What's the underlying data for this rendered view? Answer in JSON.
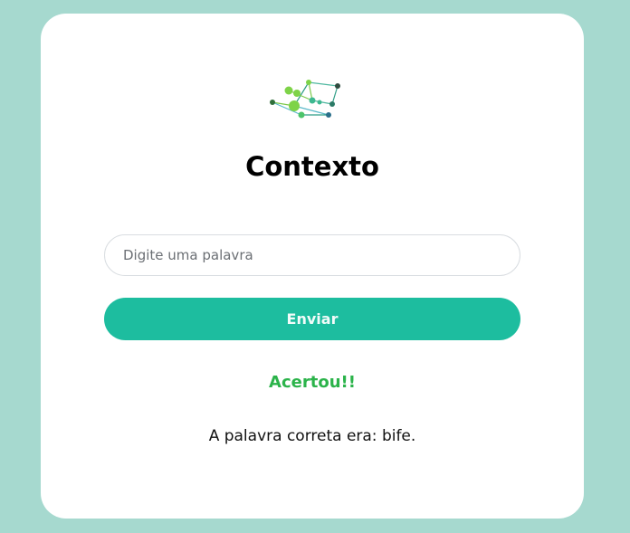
{
  "app": {
    "title": "Contexto",
    "logo_icon": "network-graph-logo-icon"
  },
  "form": {
    "input_value": "",
    "input_placeholder": "Digite uma palavra",
    "submit_label": "Enviar"
  },
  "result": {
    "status": "Acertou!!",
    "message": "A palavra correta era: bife."
  },
  "colors": {
    "background": "#a6d9cf",
    "card": "#ffffff",
    "button": "#1dbd9f",
    "success": "#2bb34a"
  }
}
